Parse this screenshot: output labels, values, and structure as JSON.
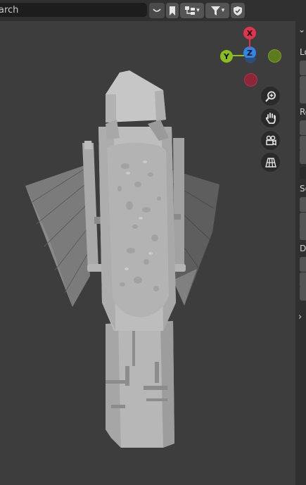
{
  "header": {
    "search_placeholder": "earch"
  },
  "toolbar": {
    "items": [
      "view-toggle",
      "bookmark",
      "display-mode",
      "filter",
      "restrict-toggle"
    ]
  },
  "gizmo": {
    "x_label": "X",
    "y_label": "Y",
    "z_label": "Z",
    "colors": {
      "x": "#e0334f",
      "y": "#8bbd1e",
      "z": "#2f86e6"
    }
  },
  "sidebar": {
    "labels": [
      "Lo",
      "Ro",
      "Sc",
      "D"
    ],
    "field_groups": [
      3,
      3,
      3,
      3
    ]
  }
}
